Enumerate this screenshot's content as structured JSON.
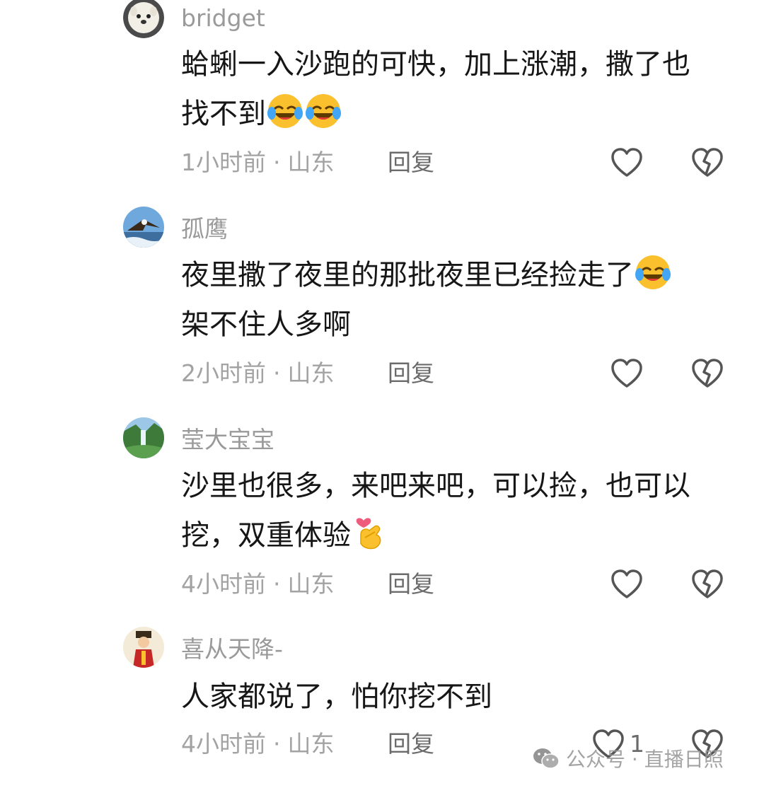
{
  "comments": [
    {
      "username": "bridget",
      "lines": [
        "蛤蜊一入沙跑的可快，加上涨潮，撒了也",
        "找不到"
      ],
      "time": "1小时前",
      "location": "山东",
      "reply": "回复",
      "like_count": "",
      "avatar_icon": "dog-avatar-icon",
      "emojis": [
        "laughing-tears-emoji",
        "laughing-tears-emoji"
      ]
    },
    {
      "username": "孤鹰",
      "lines": [
        "夜里撒了夜里的那批夜里已经捡走了",
        "架不住人多啊"
      ],
      "time": "2小时前",
      "location": "山东",
      "reply": "回复",
      "like_count": "",
      "avatar_icon": "eagle-avatar-icon",
      "emojis": [
        "laughing-tears-emoji"
      ]
    },
    {
      "username": "莹大宝宝",
      "lines": [
        "沙里也很多，来吧来吧，可以捡，也可以",
        "挖，双重体验"
      ],
      "time": "4小时前",
      "location": "山东",
      "reply": "回复",
      "like_count": "",
      "avatar_icon": "waterfall-avatar-icon",
      "emojis": [
        "finger-heart-emoji"
      ]
    },
    {
      "username": "喜从天降-",
      "lines": [
        "人家都说了，怕你挖不到"
      ],
      "time": "4小时前",
      "location": "山东",
      "reply": "回复",
      "like_count": "1",
      "avatar_icon": "fortune-god-avatar-icon",
      "emojis": []
    }
  ],
  "separator": "·",
  "watermark": {
    "text": "公众号 · 直播日照",
    "icon": "wechat-icon"
  },
  "colors": {
    "text": "#161616",
    "meta": "#a3a3a3",
    "username": "#9a9a9a",
    "icon_stroke": "#555555"
  }
}
